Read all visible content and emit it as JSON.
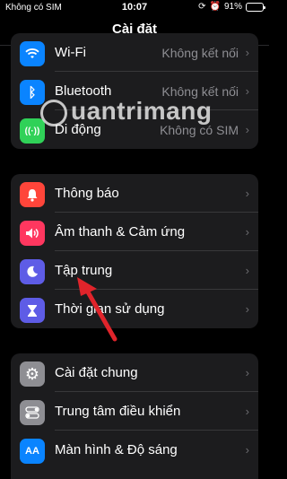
{
  "status_bar": {
    "carrier": "Không có SIM",
    "time": "10:07",
    "battery": "91%",
    "battery_level": 0.91,
    "icons": [
      "alarm-icon",
      "lock-rotation-icon"
    ]
  },
  "nav": {
    "title": "Cài đặt"
  },
  "groups": {
    "connectivity": [
      {
        "label": "Wi-Fi",
        "value": "Không kết nối",
        "icon": "wifi-icon",
        "color": "#0a84ff",
        "glyph": "📶"
      },
      {
        "label": "Bluetooth",
        "value": "Không kết nối",
        "icon": "bluetooth-icon",
        "color": "#0a84ff",
        "glyph": "ᛒ"
      },
      {
        "label": "Di động",
        "value": "Không có SIM",
        "icon": "cellular-icon",
        "color": "#30d158",
        "glyph": "((·))"
      }
    ],
    "notifications": [
      {
        "label": "Thông báo",
        "icon": "bell-icon",
        "color": "#ff453a",
        "glyph": "🔔"
      },
      {
        "label": "Âm thanh & Cảm ứng",
        "icon": "speaker-icon",
        "color": "#ff375f",
        "glyph": "🔊"
      },
      {
        "label": "Tập trung",
        "icon": "moon-icon",
        "color": "#5e5ce6",
        "glyph": "☾"
      },
      {
        "label": "Thời gian sử dụng",
        "icon": "hourglass-icon",
        "color": "#5e5ce6",
        "glyph": "⧗"
      }
    ],
    "general": [
      {
        "label": "Cài đặt chung",
        "icon": "gear-icon",
        "color": "#8e8e93",
        "glyph": "⚙"
      },
      {
        "label": "Trung tâm điều khiển",
        "icon": "toggles-icon",
        "color": "#8e8e93",
        "glyph": "⇄"
      },
      {
        "label": "Màn hình & Độ sáng",
        "icon": "display-brightness-icon",
        "color": "#0a84ff",
        "glyph": "AA"
      }
    ]
  },
  "chevron": "›",
  "watermark": "uantrimang",
  "annotation": {
    "arrow_color": "#e0242b",
    "arrow_target": "Tập trung"
  }
}
